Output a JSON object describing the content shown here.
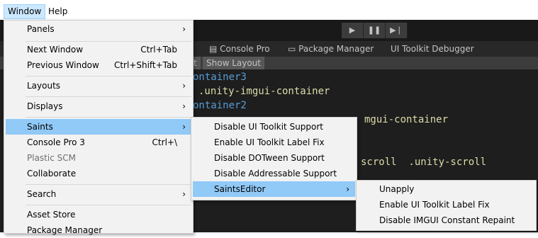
{
  "menubar": {
    "window": "Window",
    "help": "Help"
  },
  "toolbar": {
    "play_icon": "play-icon",
    "pause_icon": "pause-icon",
    "step_icon": "step-icon"
  },
  "tabs": {
    "console_pro": "Console Pro",
    "package_manager": "Package Manager",
    "ui_toolkit_debugger": "UI Toolkit Debugger"
  },
  "subbar": {
    "partial": "t",
    "show_layout": "Show Layout"
  },
  "code": [
    {
      "text": "ontainer3",
      "color": "blue"
    },
    {
      "text": ".unity-imgui-container",
      "color": "yellow"
    },
    {
      "text": "ontainer2",
      "color": "blue"
    },
    {
      "text": "mgui-container",
      "color": "yellow"
    },
    {
      "text": "scroll  .unity-scroll",
      "color": "yellow"
    }
  ],
  "window_menu": {
    "items": [
      {
        "label": "Panels",
        "submenu": true
      },
      {
        "label": "Next Window",
        "shortcut": "Ctrl+Tab"
      },
      {
        "label": "Previous Window",
        "shortcut": "Ctrl+Shift+Tab"
      },
      {
        "label": "Layouts",
        "submenu": true
      },
      {
        "label": "Displays",
        "submenu": true
      },
      {
        "label": "Saints",
        "submenu": true,
        "highlighted": true
      },
      {
        "label": "Console Pro 3",
        "shortcut": "Ctrl+\\"
      },
      {
        "label": "Plastic SCM",
        "disabled": true
      },
      {
        "label": "Collaborate"
      },
      {
        "label": "Search",
        "submenu": true
      },
      {
        "label": "Asset Store"
      },
      {
        "label": "Package Manager"
      }
    ]
  },
  "saints_menu": {
    "items": [
      {
        "label": "Disable UI Toolkit Support"
      },
      {
        "label": "Enable UI Toolkit Label Fix"
      },
      {
        "label": "Disable DOTween Support"
      },
      {
        "label": "Disable Addressable Support"
      },
      {
        "label": "SaintsEditor",
        "submenu": true,
        "highlighted": true
      }
    ]
  },
  "saintseditor_menu": {
    "items": [
      {
        "label": "Unapply"
      },
      {
        "label": "Enable UI Toolkit Label Fix"
      },
      {
        "label": "Disable IMGUI Constant Repaint"
      }
    ]
  },
  "arrow_glyph": "›",
  "colors": {
    "highlight": "#91c9f7",
    "menu_bg": "#f2f2f2",
    "editor_bg": "#1e1e1e"
  }
}
